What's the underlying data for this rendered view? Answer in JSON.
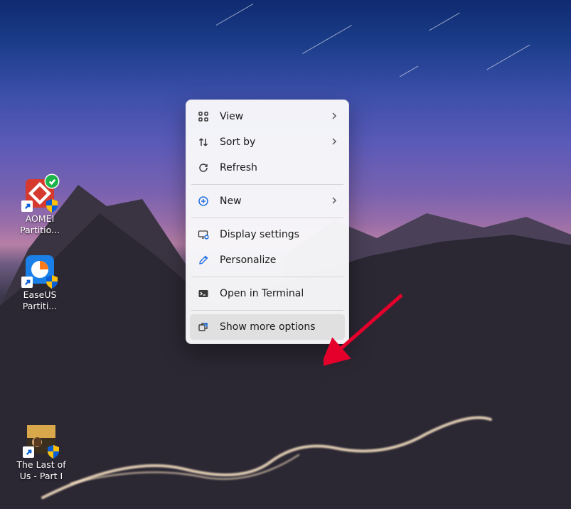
{
  "desktop_icons": [
    {
      "label": "AOMEI\nPartitio..."
    },
    {
      "label": "EaseUS\nPartiti..."
    }
  ],
  "desktop_icon_lastofus": {
    "label": "The Last of\nUs - Part I"
  },
  "context_menu": {
    "view": "View",
    "sort_by": "Sort by",
    "refresh": "Refresh",
    "new": "New",
    "display_settings": "Display settings",
    "personalize": "Personalize",
    "open_terminal": "Open in Terminal",
    "show_more": "Show more options"
  }
}
